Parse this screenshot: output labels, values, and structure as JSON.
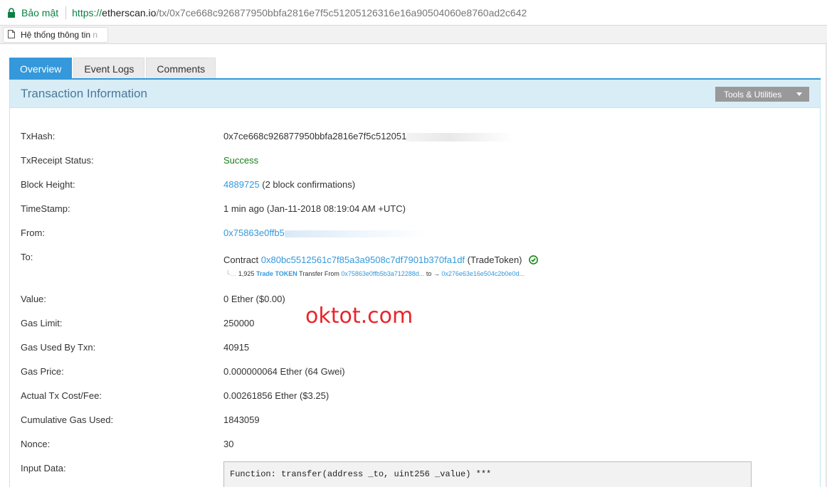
{
  "browser": {
    "secure_label": "Bảo mật",
    "url_proto": "https://",
    "url_host": "etherscan.io",
    "url_path": "/tx/0x7ce668c926877950bbfa2816e7f5c51205126316e16a90504060e8760ad2c642",
    "bookmark_label": "Hệ thống thông tin",
    "bookmark_fade": " n"
  },
  "tabs": [
    {
      "label": "Overview"
    },
    {
      "label": "Event Logs"
    },
    {
      "label": "Comments"
    }
  ],
  "panel": {
    "title": "Transaction Information",
    "tools_label": "Tools & Utilities"
  },
  "fields": {
    "txhash_label": "TxHash:",
    "txhash_value": "0x7ce668c926877950bbfa2816e7f5c512051",
    "status_label": "TxReceipt Status:",
    "status_value": "Success",
    "block_label": "Block Height:",
    "block_value": "4889725",
    "block_confirm": "(2 block confirmations)",
    "timestamp_label": "TimeStamp:",
    "timestamp_value": "1 min ago (Jan-11-2018 08:19:04 AM +UTC)",
    "from_label": "From:",
    "from_value": "0x75863e0ffb5",
    "to_label": "To:",
    "to_prefix": "Contract",
    "to_address": "0x80bc5512561c7f85a3a9508c7df7901b370fa1df",
    "to_name": "(TradeToken)",
    "transfer_dots": "└…",
    "transfer_amount": "1,925",
    "transfer_token": "Trade TOKEN",
    "transfer_text": "Transfer From",
    "transfer_from": "0x75863e0ffb5b3a712288d...",
    "transfer_to_label": "to →",
    "transfer_to": "0x276e63e16e504c2b0e0d...",
    "value_label": "Value:",
    "value_value": "0 Ether ($0.00)",
    "gaslimit_label": "Gas Limit:",
    "gaslimit_value": "250000",
    "gasused_label": "Gas Used By Txn:",
    "gasused_value": "40915",
    "gasprice_label": "Gas Price:",
    "gasprice_value": "0.000000064 Ether (64 Gwei)",
    "cost_label": "Actual Tx Cost/Fee:",
    "cost_value": "0.00261856 Ether ($3.25)",
    "cumgas_label": "Cumulative Gas Used:",
    "cumgas_value": "1843059",
    "nonce_label": "Nonce:",
    "nonce_value": "30",
    "input_label": "Input Data:",
    "input_value": "Function: transfer(address _to, uint256 _value) ***"
  },
  "watermark": "oktot.com",
  "colors": {
    "accent": "#3498db",
    "panel_head": "#d9edf7",
    "success": "#1b7b1b",
    "watermark": "#e8242a"
  }
}
